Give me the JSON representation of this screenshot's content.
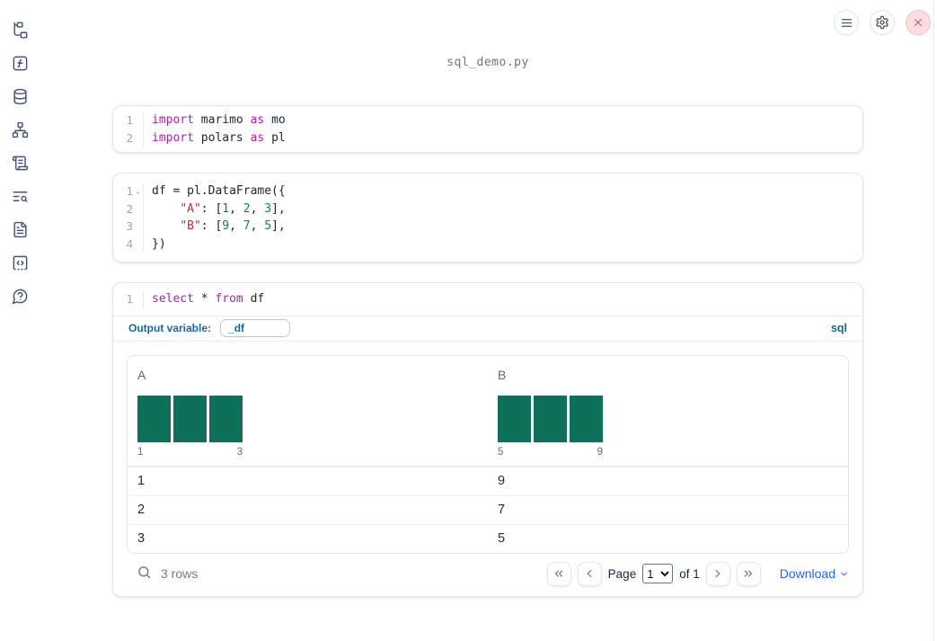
{
  "topbar": {
    "buttons": [
      {
        "icon": "menu-icon"
      },
      {
        "icon": "settings-gear-icon"
      },
      {
        "icon": "close-x-icon"
      }
    ]
  },
  "sidebar": {
    "items": [
      {
        "icon": "file-tree-icon"
      },
      {
        "icon": "function-square-icon"
      },
      {
        "icon": "database-icon"
      },
      {
        "icon": "network-icon"
      },
      {
        "icon": "scroll-text-icon"
      },
      {
        "icon": "text-search-icon"
      },
      {
        "icon": "file-text-icon"
      },
      {
        "icon": "code-box-icon"
      },
      {
        "icon": "help-bubble-icon"
      }
    ]
  },
  "header": {
    "filename": "sql_demo.py"
  },
  "cells": [
    {
      "kind": "python",
      "lines": [
        {
          "num": "1",
          "tokens": [
            {
              "t": "import"
            },
            {
              "t": " marimo "
            },
            {
              "t": "as"
            },
            {
              "t": " mo"
            }
          ]
        },
        {
          "num": "2",
          "tokens": [
            {
              "t": "import"
            },
            {
              "t": " polars "
            },
            {
              "t": "as"
            },
            {
              "t": " pl"
            }
          ]
        }
      ]
    },
    {
      "kind": "python",
      "lines": [
        {
          "num": "1",
          "fold": "⌄",
          "tokens": [
            {
              "t": "df = pl.DataFrame({"
            }
          ]
        },
        {
          "num": "2",
          "tokens": [
            {
              "t": "    "
            },
            {
              "t": "\"A\""
            },
            {
              "t": ": ["
            },
            {
              "t": "1"
            },
            {
              "t": ", "
            },
            {
              "t": "2"
            },
            {
              "t": ", "
            },
            {
              "t": "3"
            },
            {
              "t": "],"
            }
          ]
        },
        {
          "num": "3",
          "tokens": [
            {
              "t": "    "
            },
            {
              "t": "\"B\""
            },
            {
              "t": ": ["
            },
            {
              "t": "9"
            },
            {
              "t": ", "
            },
            {
              "t": "7"
            },
            {
              "t": ", "
            },
            {
              "t": "5"
            },
            {
              "t": "],"
            }
          ]
        },
        {
          "num": "4",
          "tokens": [
            {
              "t": "})"
            }
          ]
        }
      ]
    },
    {
      "kind": "sql",
      "lines": [
        {
          "num": "1",
          "tokens": [
            {
              "t": "select"
            },
            {
              "t": " * "
            },
            {
              "t": "from"
            },
            {
              "t": " df"
            }
          ]
        }
      ],
      "output_variable_label": "Output variable:",
      "output_variable_value": "_df",
      "language_badge": "sql"
    }
  ],
  "table": {
    "columns": [
      {
        "name": "A",
        "bin_min": "1",
        "bin_max": "3",
        "bar_count": 3
      },
      {
        "name": "B",
        "bin_min": "5",
        "bin_max": "9",
        "bar_count": 3
      }
    ],
    "rows": [
      {
        "A": "1",
        "B": "9"
      },
      {
        "A": "2",
        "B": "7"
      },
      {
        "A": "3",
        "B": "5"
      }
    ],
    "footer": {
      "row_count": "3 rows",
      "page_label": "Page",
      "page_value": "1",
      "of_label": "of 1",
      "download_label": "Download"
    }
  },
  "colors": {
    "histogram_bar": "#0e6f5b",
    "sql_accent_blue": "#15699e",
    "download_link_blue": "#2563eb",
    "keyword_purple": "#a626a4",
    "string_red": "#b5332a",
    "number_green": "#15803d",
    "close_button_red": "#cf5860"
  }
}
